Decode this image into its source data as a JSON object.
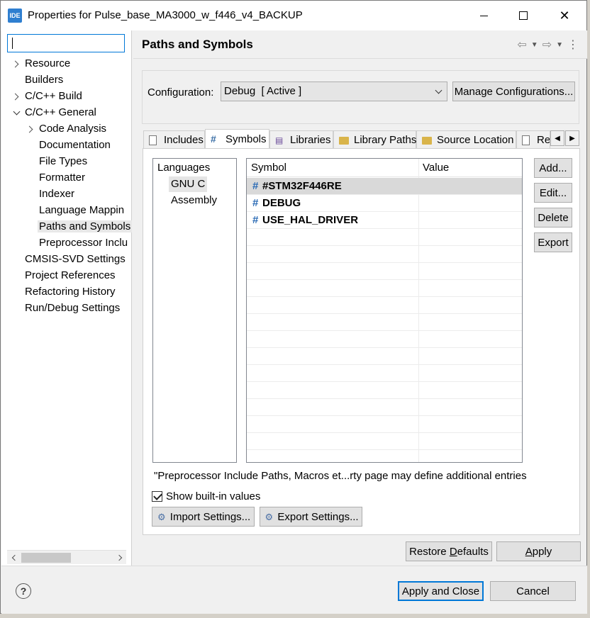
{
  "window": {
    "icon_text": "IDE",
    "title": "Properties for Pulse_base_MA3000_w_f446_v4_BACKUP"
  },
  "filter": {
    "value": ""
  },
  "tree": [
    {
      "label": "Resource",
      "twisty": "right",
      "level": 1
    },
    {
      "label": "Builders",
      "twisty": "",
      "level": 1
    },
    {
      "label": "C/C++ Build",
      "twisty": "right",
      "level": 1
    },
    {
      "label": "C/C++ General",
      "twisty": "down",
      "level": 1
    },
    {
      "label": "Code Analysis",
      "twisty": "right",
      "level": 2
    },
    {
      "label": "Documentation",
      "twisty": "",
      "level": 2
    },
    {
      "label": "File Types",
      "twisty": "",
      "level": 2
    },
    {
      "label": "Formatter",
      "twisty": "",
      "level": 2
    },
    {
      "label": "Indexer",
      "twisty": "",
      "level": 2
    },
    {
      "label": "Language Mappin",
      "twisty": "",
      "level": 2
    },
    {
      "label": "Paths and Symbols",
      "twisty": "",
      "level": 2,
      "selected": true
    },
    {
      "label": "Preprocessor Inclu",
      "twisty": "",
      "level": 2
    },
    {
      "label": "CMSIS-SVD Settings",
      "twisty": "",
      "level": 1
    },
    {
      "label": "Project References",
      "twisty": "",
      "level": 1
    },
    {
      "label": "Refactoring History",
      "twisty": "",
      "level": 1
    },
    {
      "label": "Run/Debug Settings",
      "twisty": "",
      "level": 1
    }
  ],
  "page": {
    "title": "Paths and Symbols"
  },
  "configuration": {
    "label": "Configuration:",
    "selected": "Debug  [ Active ]",
    "manage_label": "Manage Configurations..."
  },
  "tabs": [
    {
      "label": "Includes",
      "icon": "includes-icon",
      "active": false
    },
    {
      "label": "Symbols",
      "icon": "hash-icon",
      "active": true
    },
    {
      "label": "Libraries",
      "icon": "libraries-icon",
      "active": false
    },
    {
      "label": "Library Paths",
      "icon": "folder-icon",
      "active": false
    },
    {
      "label": "Source Location",
      "icon": "folder-icon",
      "active": false
    },
    {
      "label": "Re",
      "icon": "file-icon",
      "active": false
    }
  ],
  "languages": {
    "header": "Languages",
    "items": [
      "GNU C",
      "Assembly"
    ]
  },
  "symbols": {
    "col_symbol": "Symbol",
    "col_value": "Value",
    "rows": [
      {
        "symbol": "#STM32F446RE",
        "value": ""
      },
      {
        "symbol": "DEBUG",
        "value": ""
      },
      {
        "symbol": "USE_HAL_DRIVER",
        "value": ""
      }
    ]
  },
  "side_buttons": {
    "add": "Add...",
    "edit": "Edit...",
    "delete": "Delete",
    "export": "Export"
  },
  "note": "\"Preprocessor Include Paths, Macros et...rty page may define additional entries",
  "show_builtin": {
    "label": "Show built-in values",
    "checked": true
  },
  "import_settings": "Import Settings...",
  "export_settings": "Export Settings...",
  "restore_defaults_pre": "Restore ",
  "restore_defaults_u": "D",
  "restore_defaults_post": "efaults",
  "apply_u": "A",
  "apply_post": "pply",
  "apply_close": "Apply and Close",
  "cancel": "Cancel",
  "colors": {
    "accent": "#0078d7",
    "hash": "#2b6bb5"
  }
}
